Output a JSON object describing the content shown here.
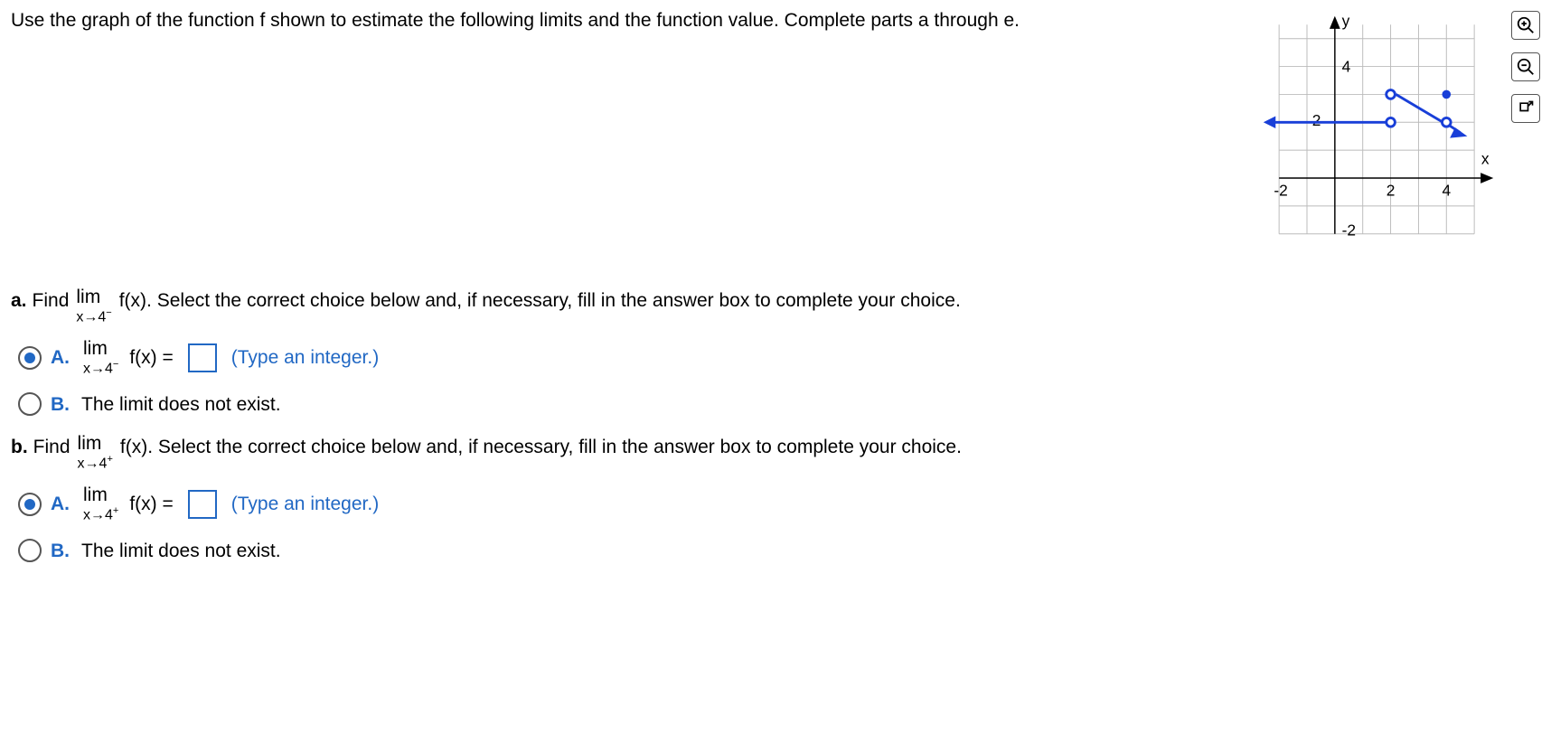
{
  "instructions": "Use the graph of the function f shown to estimate the following limits and the function value. Complete parts a through e.",
  "axis": {
    "xlabel": "x",
    "ylabel": "y",
    "ticks": {
      "xneg": "-2",
      "xpos2": "2",
      "xpos4": "4",
      "ypos4": "4",
      "ypos2": "2",
      "yneg2": "-2"
    }
  },
  "partA": {
    "label": "a.",
    "prompt_pre": "Find",
    "prompt_post": "Select the correct choice below and, if necessary, fill in the answer box to complete your choice.",
    "lim_text": "lim",
    "lim_sub": "x→4",
    "lim_sign": "−",
    "fx": "f(x).",
    "optA_letter": "A.",
    "optA_fx": "f(x) =",
    "optA_hint": "(Type an integer.)",
    "optB_letter": "B.",
    "optB_text": "The limit does not exist."
  },
  "partB": {
    "label": "b.",
    "prompt_pre": "Find",
    "prompt_post": "Select the correct choice below and, if necessary, fill in the answer box to complete your choice.",
    "lim_text": "lim",
    "lim_sub": "x→4",
    "lim_sign": "+",
    "fx": "f(x).",
    "optA_letter": "A.",
    "optA_fx": "f(x) =",
    "optA_hint": "(Type an integer.)",
    "optB_letter": "B.",
    "optB_text": "The limit does not exist."
  },
  "chart_data": {
    "type": "line",
    "xlim": [
      -3,
      5
    ],
    "ylim": [
      -2.5,
      5
    ],
    "series": [
      {
        "name": "segment-left",
        "points": [
          [
            -3,
            2
          ],
          [
            2,
            2
          ]
        ],
        "left_arrow": true,
        "right_open": true
      },
      {
        "name": "segment-right",
        "points": [
          [
            2,
            3
          ],
          [
            4,
            2
          ]
        ],
        "left_open": true,
        "right_open": true,
        "right_arrow": true
      }
    ],
    "points": [
      {
        "x": 4,
        "y": 3,
        "filled": true
      }
    ]
  }
}
